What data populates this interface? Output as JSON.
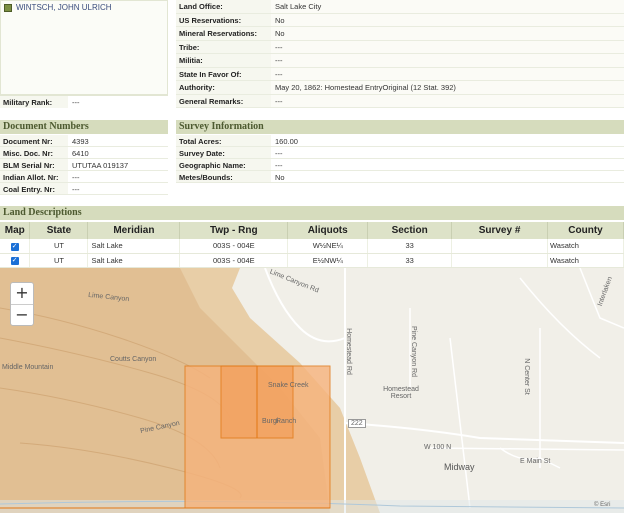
{
  "patentee": {
    "name": "WINTSCH, JOHN ULRICH"
  },
  "military_rank": {
    "label": "Military Rank:",
    "value": "---"
  },
  "details": [
    {
      "label": "Land Office:",
      "value": "Salt Lake City"
    },
    {
      "label": "US Reservations:",
      "value": "No"
    },
    {
      "label": "Mineral Reservations:",
      "value": "No"
    },
    {
      "label": "Tribe:",
      "value": "---"
    },
    {
      "label": "Militia:",
      "value": "---"
    },
    {
      "label": "State In Favor Of:",
      "value": "---"
    },
    {
      "label": "Authority:",
      "value": "May 20, 1862: Homestead EntryOriginal (12 Stat. 392)"
    },
    {
      "label": "General Remarks:",
      "value": "---"
    }
  ],
  "document_numbers": {
    "title": "Document Numbers",
    "rows": [
      {
        "label": "Document Nr:",
        "value": "4393"
      },
      {
        "label": "Misc. Doc. Nr:",
        "value": "6410"
      },
      {
        "label": "BLM Serial Nr:",
        "value": "UTUTAA 019137"
      },
      {
        "label": "Indian Allot. Nr:",
        "value": "---"
      },
      {
        "label": "Coal Entry. Nr:",
        "value": "---"
      }
    ]
  },
  "survey_information": {
    "title": "Survey Information",
    "rows": [
      {
        "label": "Total Acres:",
        "value": "160.00"
      },
      {
        "label": "Survey Date:",
        "value": "---"
      },
      {
        "label": "Geographic Name:",
        "value": "---"
      },
      {
        "label": "Metes/Bounds:",
        "value": "No"
      }
    ]
  },
  "land_descriptions": {
    "title": "Land Descriptions",
    "columns": [
      "Map",
      "State",
      "Meridian",
      "Twp - Rng",
      "Aliquots",
      "Section",
      "Survey #",
      "County"
    ],
    "rows": [
      {
        "map_checked": true,
        "state": "UT",
        "meridian": "Salt Lake",
        "twp_rng": "003S - 004E",
        "aliquots": "W½NE¼",
        "section": "33",
        "survey": "",
        "county": "Wasatch"
      },
      {
        "map_checked": true,
        "state": "UT",
        "meridian": "Salt Lake",
        "twp_rng": "003S - 004E",
        "aliquots": "E½NW¼",
        "section": "33",
        "survey": "",
        "county": "Wasatch"
      }
    ]
  },
  "map": {
    "zoom_in": "+",
    "zoom_out": "−",
    "labels": {
      "lime_canyon": "Lime Canyon",
      "coutts_canyon": "Coutts Canyon",
      "middle_mountain": "Middle Mountain",
      "pine_canyon": "Pine Canyon",
      "homestead_rd": "Homestead Rd",
      "pine_canyon_rd": "Pine Canyon Rd",
      "homestead_resort": "Homestead Resort",
      "n_center_st": "N Center St",
      "w_100_n": "W 100 N",
      "midway": "Midway",
      "e_main_st": "E Main St",
      "route_222": "222",
      "snake_creek": "Snake Creek",
      "lime_canyon_rd": "Lime Canyon Rd",
      "interlaken": "Interlaken",
      "burgi": "Burgi",
      "ranch": "Ranch",
      "attribution": "© Esri"
    },
    "colors": {
      "parcel": "#ff8c1a",
      "terrain": "#e4c79a"
    }
  }
}
